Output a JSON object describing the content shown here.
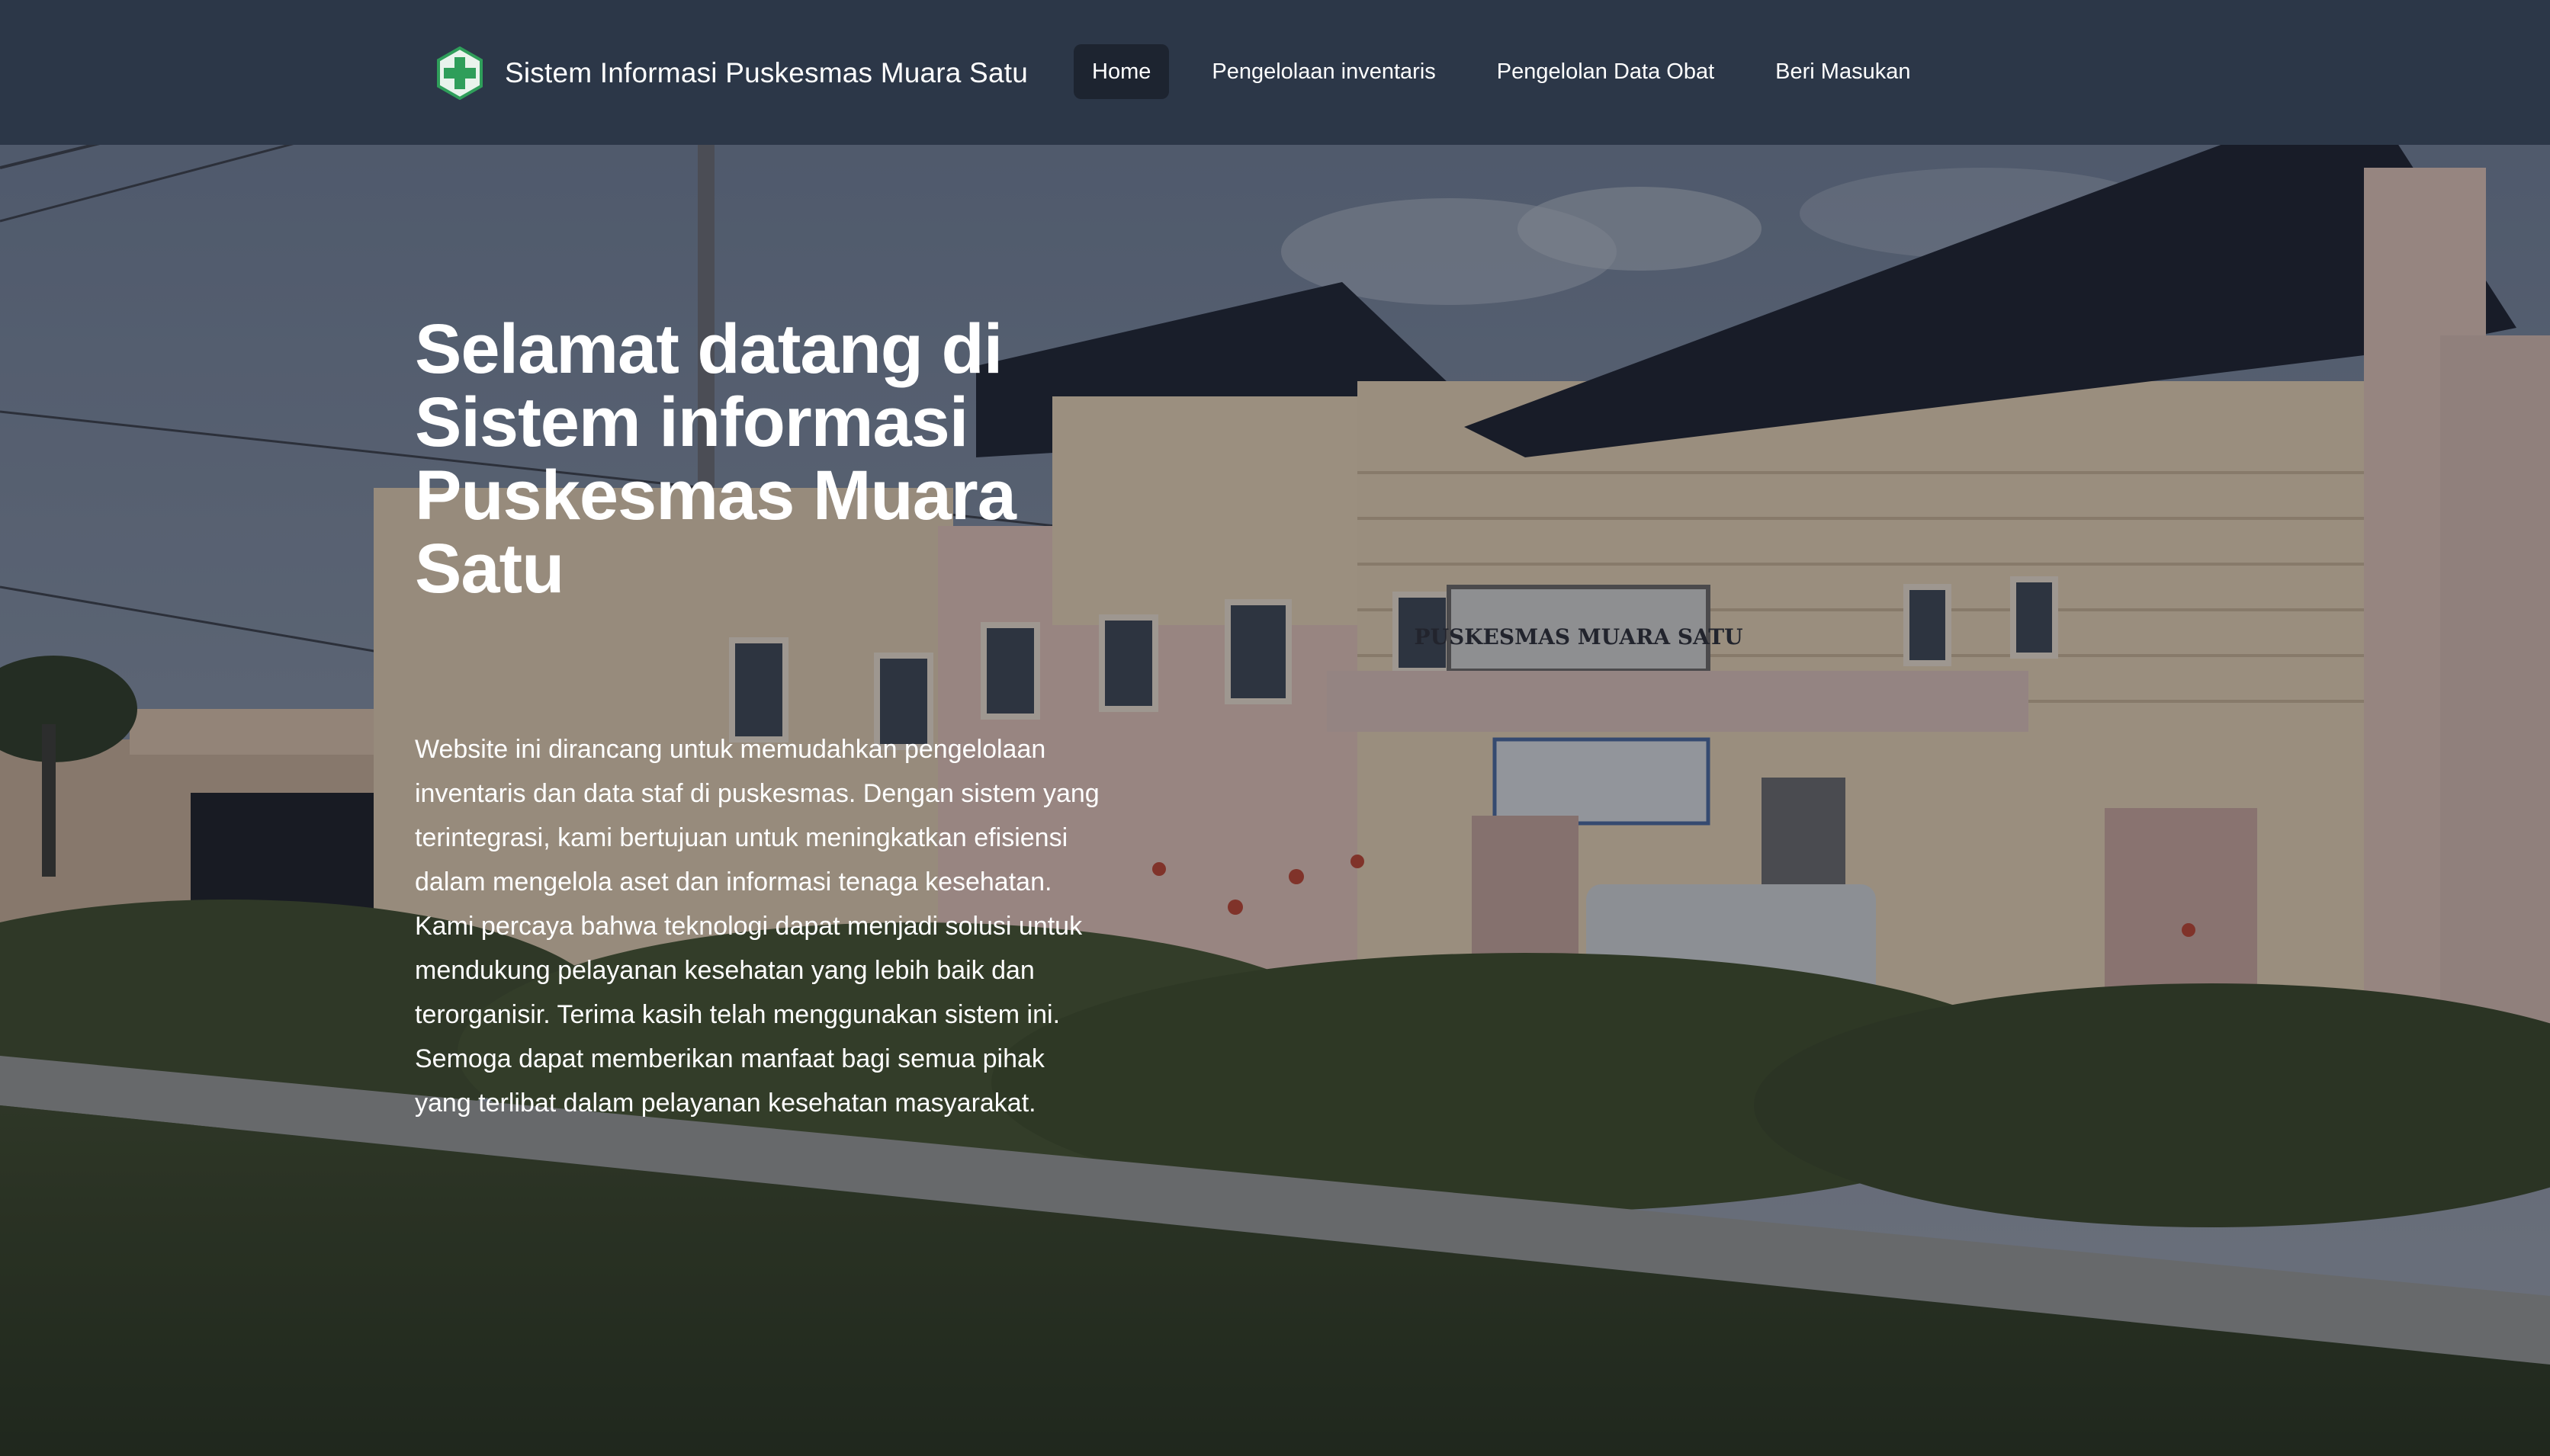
{
  "navbar": {
    "logo_icon": "health-cross-icon",
    "brand_title": "Sistem Informasi Puskesmas Muara Satu",
    "items": [
      {
        "label": "Home",
        "active": true
      },
      {
        "label": "Pengelolaan inventaris",
        "active": false
      },
      {
        "label": "Pengelolan Data Obat",
        "active": false
      },
      {
        "label": "Beri Masukan",
        "active": false
      }
    ]
  },
  "hero": {
    "title": "Selamat datang di Sistem informasi Puskesmas Muara Satu",
    "description": "Website ini dirancang untuk memudahkan pengelolaan inventaris dan data staf di puskesmas. Dengan sistem yang terintegrasi, kami bertujuan untuk meningkatkan efisiensi dalam mengelola aset dan informasi tenaga kesehatan. Kami percaya bahwa teknologi dapat menjadi solusi untuk mendukung pelayanan kesehatan yang lebih baik dan terorganisir. Terima kasih telah menggunakan sistem ini. Semoga dapat memberikan manfaat bagi semua pihak yang terlibat dalam pelayanan kesehatan masyarakat."
  },
  "background": {
    "sign_text": "PUSKESMAS MUARA SATU"
  },
  "colors": {
    "navbar_bg": "#2c3748",
    "active_nav_bg": "#1d2430",
    "logo_green": "#2f9e5a",
    "text": "#ffffff"
  }
}
